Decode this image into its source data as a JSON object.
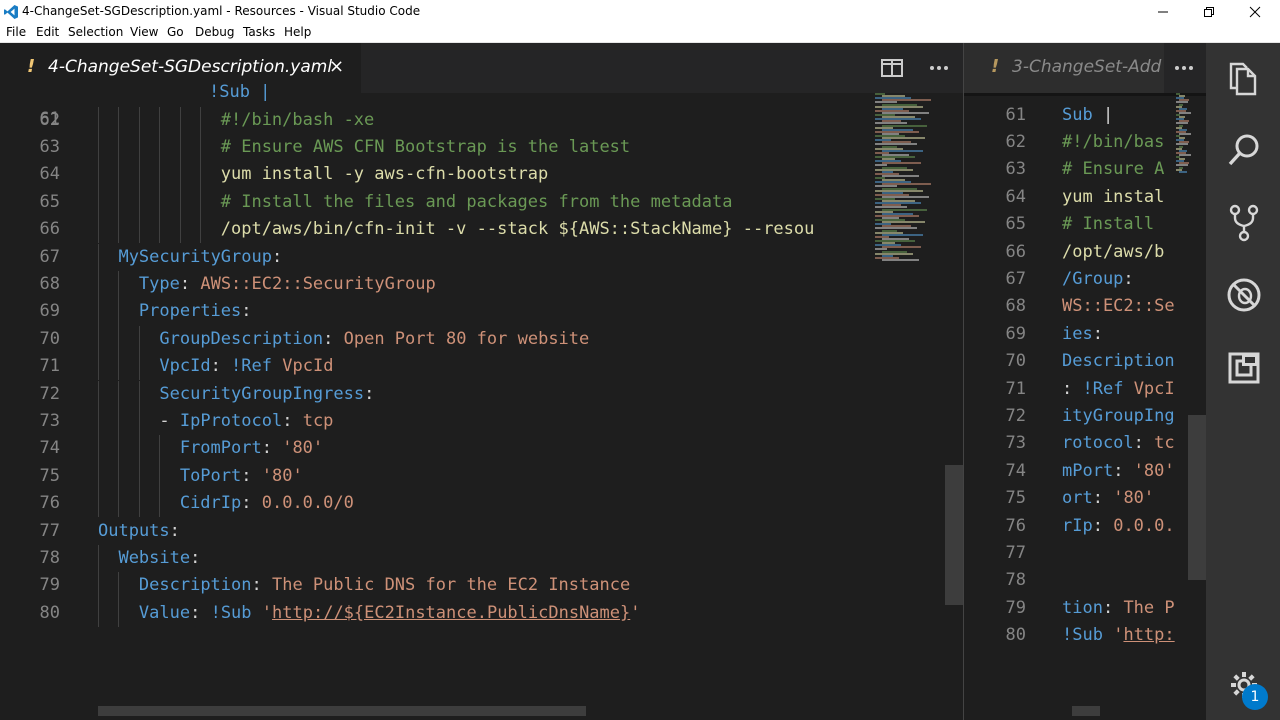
{
  "window": {
    "title": "4-ChangeSet-SGDescription.yaml - Resources - Visual Studio Code"
  },
  "menu": [
    "File",
    "Edit",
    "Selection",
    "View",
    "Go",
    "Debug",
    "Tasks",
    "Help"
  ],
  "left_editor": {
    "tab": {
      "modified_marker": "!",
      "label": "4-ChangeSet-SGDescription.yaml",
      "close": "×"
    },
    "partial_top_line": "!Sub |",
    "lines": [
      {
        "n": "62",
        "parts": [
          [
            "c",
            "#!/bin/bash -xe"
          ]
        ]
      },
      {
        "n": "63",
        "parts": [
          [
            "c",
            "# Ensure AWS CFN Bootstrap is the latest"
          ]
        ]
      },
      {
        "n": "64",
        "parts": [
          [
            "y",
            "yum install -y aws-cfn-bootstrap"
          ]
        ]
      },
      {
        "n": "65",
        "parts": [
          [
            "c",
            "# Install the files and packages from the metadata"
          ]
        ]
      },
      {
        "n": "66",
        "parts": [
          [
            "y",
            "/opt/aws/bin/cfn-init -v --stack ${AWS::StackName} --resou"
          ]
        ]
      },
      {
        "n": "67",
        "parts": [
          [
            "k",
            "MySecurityGroup"
          ],
          [
            "p",
            ":"
          ]
        ]
      },
      {
        "n": "68",
        "parts": [
          [
            "k",
            "Type"
          ],
          [
            "p",
            ": "
          ],
          [
            "s",
            "AWS::EC2::SecurityGroup"
          ]
        ]
      },
      {
        "n": "69",
        "parts": [
          [
            "k",
            "Properties"
          ],
          [
            "p",
            ":"
          ]
        ]
      },
      {
        "n": "70",
        "parts": [
          [
            "k",
            "GroupDescription"
          ],
          [
            "p",
            ": "
          ],
          [
            "s",
            "Open Port 80 for website"
          ]
        ]
      },
      {
        "n": "71",
        "parts": [
          [
            "k",
            "VpcId"
          ],
          [
            "p",
            ": "
          ],
          [
            "k",
            "!Ref"
          ],
          [
            "p",
            " "
          ],
          [
            "s",
            "VpcId"
          ]
        ]
      },
      {
        "n": "72",
        "parts": [
          [
            "k",
            "SecurityGroupIngress"
          ],
          [
            "p",
            ":"
          ]
        ]
      },
      {
        "n": "73",
        "parts": [
          [
            "p",
            "- "
          ],
          [
            "k",
            "IpProtocol"
          ],
          [
            "p",
            ": "
          ],
          [
            "s",
            "tcp"
          ]
        ]
      },
      {
        "n": "74",
        "parts": [
          [
            "k",
            "FromPort"
          ],
          [
            "p",
            ": "
          ],
          [
            "s",
            "'80'"
          ]
        ]
      },
      {
        "n": "75",
        "parts": [
          [
            "k",
            "ToPort"
          ],
          [
            "p",
            ": "
          ],
          [
            "s",
            "'80'"
          ]
        ]
      },
      {
        "n": "76",
        "parts": [
          [
            "k",
            "CidrIp"
          ],
          [
            "p",
            ": "
          ],
          [
            "s",
            "0.0.0.0/0"
          ]
        ]
      },
      {
        "n": "77",
        "parts": [
          [
            "k",
            "Outputs"
          ],
          [
            "p",
            ":"
          ]
        ]
      },
      {
        "n": "78",
        "parts": [
          [
            "k",
            "Website"
          ],
          [
            "p",
            ":"
          ]
        ]
      },
      {
        "n": "79",
        "parts": [
          [
            "k",
            "Description"
          ],
          [
            "p",
            ": "
          ],
          [
            "s",
            "The Public DNS for the EC2 Instance"
          ]
        ]
      },
      {
        "n": "80",
        "parts": [
          [
            "k",
            "Value"
          ],
          [
            "p",
            ": "
          ],
          [
            "k",
            "!Sub"
          ],
          [
            "p",
            " "
          ],
          [
            "s",
            "'"
          ],
          [
            "su",
            "http://${EC2Instance.PublicDnsName}"
          ],
          [
            "s",
            "'"
          ]
        ]
      }
    ]
  },
  "right_editor": {
    "tab": {
      "modified_marker": "!",
      "label": "3-ChangeSet-Add"
    },
    "lines": [
      {
        "n": "61",
        "parts": [
          [
            "k",
            "Sub"
          ],
          [
            "p",
            " |"
          ]
        ]
      },
      {
        "n": "62",
        "parts": [
          [
            "c",
            "#!/bin/bas"
          ]
        ]
      },
      {
        "n": "63",
        "parts": [
          [
            "c",
            "# Ensure A"
          ]
        ]
      },
      {
        "n": "64",
        "parts": [
          [
            "y",
            "yum instal"
          ]
        ]
      },
      {
        "n": "65",
        "parts": [
          [
            "c",
            "# Install "
          ]
        ]
      },
      {
        "n": "66",
        "parts": [
          [
            "y",
            "/opt/aws/b"
          ]
        ]
      },
      {
        "n": "67",
        "parts": [
          [
            "k",
            "/Group"
          ],
          [
            "p",
            ":"
          ]
        ]
      },
      {
        "n": "68",
        "parts": [
          [
            "s",
            "WS::EC2::Se"
          ]
        ]
      },
      {
        "n": "69",
        "parts": [
          [
            "k",
            "ies"
          ],
          [
            "p",
            ":"
          ]
        ]
      },
      {
        "n": "70",
        "parts": [
          [
            "k",
            "Description"
          ]
        ]
      },
      {
        "n": "71",
        "parts": [
          [
            "p",
            ": "
          ],
          [
            "k",
            "!Ref"
          ],
          [
            "p",
            " "
          ],
          [
            "s",
            "VpcI"
          ]
        ]
      },
      {
        "n": "72",
        "parts": [
          [
            "k",
            "ityGroupIng"
          ]
        ]
      },
      {
        "n": "73",
        "parts": [
          [
            "k",
            "rotocol"
          ],
          [
            "p",
            ": "
          ],
          [
            "s",
            "tc"
          ]
        ]
      },
      {
        "n": "74",
        "parts": [
          [
            "k",
            "mPort"
          ],
          [
            "p",
            ": "
          ],
          [
            "s",
            "'80'"
          ]
        ]
      },
      {
        "n": "75",
        "parts": [
          [
            "k",
            "ort"
          ],
          [
            "p",
            ": "
          ],
          [
            "s",
            "'80'"
          ]
        ]
      },
      {
        "n": "76",
        "parts": [
          [
            "k",
            "rIp"
          ],
          [
            "p",
            ": "
          ],
          [
            "s",
            "0.0.0."
          ]
        ]
      },
      {
        "n": "77",
        "parts": []
      },
      {
        "n": "78",
        "parts": []
      },
      {
        "n": "79",
        "parts": [
          [
            "k",
            "tion"
          ],
          [
            "p",
            ": "
          ],
          [
            "s",
            "The P"
          ]
        ]
      },
      {
        "n": "80",
        "parts": [
          [
            "k",
            "!Sub"
          ],
          [
            "p",
            " "
          ],
          [
            "s",
            "'"
          ],
          [
            "su",
            "http:"
          ]
        ]
      }
    ]
  },
  "activity_bar": {
    "icons": [
      "explorer-icon",
      "search-icon",
      "source-control-icon",
      "debug-icon",
      "extensions-icon",
      "settings-gear-icon"
    ],
    "badge": "1"
  },
  "colors": {
    "keyword": "#569cd6",
    "string": "#ce9178",
    "comment": "#6a9955",
    "command": "#dcdcaa",
    "punct": "#d4d4d4",
    "accent": "#007acc"
  }
}
